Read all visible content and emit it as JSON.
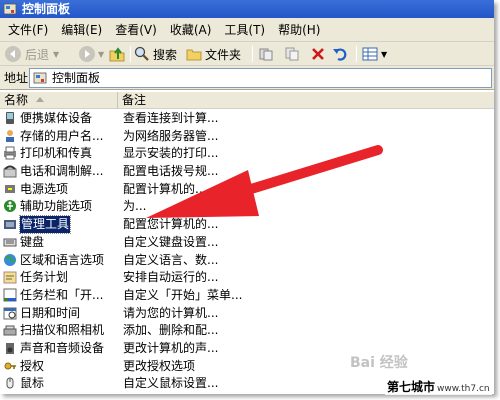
{
  "window": {
    "title": "控制面板"
  },
  "menu": [
    "文件(F)",
    "编辑(E)",
    "查看(V)",
    "收藏(A)",
    "工具(T)",
    "帮助(H)"
  ],
  "toolbar": {
    "back": "后退",
    "search": "搜索",
    "folders": "文件夹"
  },
  "address": {
    "label": "地址(D)",
    "value": "控制面板"
  },
  "list": {
    "columns": [
      "名称",
      "备注"
    ],
    "rows": [
      {
        "name": "便携媒体设备",
        "comment": "查看连接到计算...",
        "icon": "portable-media-icon"
      },
      {
        "name": "存储的用户名...",
        "comment": "为网络服务器管...",
        "icon": "stored-users-icon"
      },
      {
        "name": "打印机和传真",
        "comment": "显示安装的打印...",
        "icon": "printer-icon"
      },
      {
        "name": "电话和调制解...",
        "comment": "配置电话拨号规...",
        "icon": "phone-icon"
      },
      {
        "name": "电源选项",
        "comment": "配置计算机的...",
        "icon": "power-icon"
      },
      {
        "name": "辅助功能选项",
        "comment": "为...",
        "icon": "accessibility-icon"
      },
      {
        "name": "管理工具",
        "comment": "配置您计算机的...",
        "icon": "admin-tools-icon",
        "selected": true
      },
      {
        "name": "键盘",
        "comment": "自定义键盘设置...",
        "icon": "keyboard-icon"
      },
      {
        "name": "区域和语言选项",
        "comment": "自定义语言、数...",
        "icon": "globe-icon"
      },
      {
        "name": "任务计划",
        "comment": "安排自动运行的...",
        "icon": "task-scheduler-icon"
      },
      {
        "name": "任务栏和「开...",
        "comment": "自定义「开始」菜单...",
        "icon": "taskbar-icon"
      },
      {
        "name": "日期和时间",
        "comment": "请为您的计算机...",
        "icon": "calendar-icon"
      },
      {
        "name": "扫描仪和照相机",
        "comment": "添加、删除和配...",
        "icon": "scanner-icon"
      },
      {
        "name": "声音和音频设备",
        "comment": "更改计算机的声...",
        "icon": "speaker-icon"
      },
      {
        "name": "授权",
        "comment": "更改授权选项",
        "icon": "license-icon"
      },
      {
        "name": "鼠标",
        "comment": "自定义鼠标设置...",
        "icon": "mouse-icon"
      },
      {
        "name": "添加或删除程序",
        "comment": "安装或删除程序...",
        "icon": "add-remove-icon"
      }
    ]
  },
  "watermark": {
    "site": "第七城市",
    "url": "www.th7.cn",
    "logo": "Bai 经验"
  },
  "colors": {
    "titlebar": "#2d5fd1",
    "selection": "#0a246a",
    "arrow": "#e8242a",
    "chrome": "#ece9d8"
  }
}
